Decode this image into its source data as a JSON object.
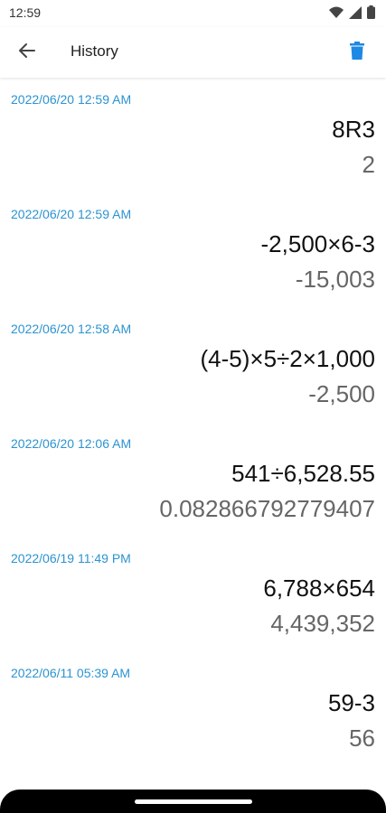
{
  "status_bar": {
    "time": "12:59",
    "icons": [
      "wifi-icon",
      "signal-icon",
      "battery-icon"
    ]
  },
  "app_bar": {
    "title": "History",
    "back_icon": "arrow-back-icon",
    "delete_icon": "trash-icon",
    "accent_color": "#1e88e5"
  },
  "history": [
    {
      "date": "2022/06/20 12:59 AM",
      "expression": "8R3",
      "result": "2"
    },
    {
      "date": "2022/06/20 12:59 AM",
      "expression": "-2,500×6-3",
      "result": "-15,003"
    },
    {
      "date": "2022/06/20 12:58 AM",
      "expression": "(4-5)×5÷2×1,000",
      "result": "-2,500"
    },
    {
      "date": "2022/06/20 12:06 AM",
      "expression": "541÷6,528.55",
      "result": "0.082866792779407"
    },
    {
      "date": "2022/06/19 11:49 PM",
      "expression": "6,788×654",
      "result": "4,439,352"
    },
    {
      "date": "2022/06/11 05:39 AM",
      "expression": "59-3",
      "result": "56"
    }
  ],
  "colors": {
    "date_text": "#2b93d1",
    "expression_text": "#111111",
    "result_text": "#666666"
  }
}
